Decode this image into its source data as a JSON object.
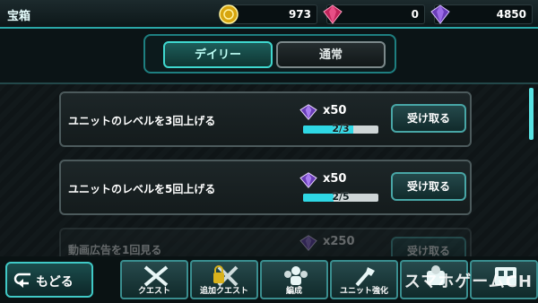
{
  "header": {
    "title": "宝箱",
    "currencies": [
      {
        "name": "gold-coin",
        "value": "973",
        "color": "#f0c419"
      },
      {
        "name": "red-gem",
        "value": "0",
        "color": "#d0336a"
      },
      {
        "name": "purple-gem",
        "value": "4850",
        "color": "#8a5bd6"
      }
    ]
  },
  "tabs": [
    {
      "label": "デイリー",
      "active": true
    },
    {
      "label": "通常",
      "active": false
    }
  ],
  "missions": [
    {
      "text": "ユニットのレベルを3回上げる",
      "reward": "x50",
      "progress": "2/3",
      "progress_ratio": 0.667,
      "button": "受け取る"
    },
    {
      "text": "ユニットのレベルを5回上げる",
      "reward": "x50",
      "progress": "2/5",
      "progress_ratio": 0.4,
      "button": "受け取る"
    },
    {
      "text": "動画広告を1回見る",
      "reward": "x250",
      "progress": "",
      "progress_ratio": 0,
      "button": "受け取る"
    }
  ],
  "bottom_nav": {
    "back_label": "もどる",
    "items": [
      {
        "label": "クエスト",
        "icon": "quest-icon"
      },
      {
        "label": "追加クエスト",
        "icon": "extra-quest-icon"
      },
      {
        "label": "編成",
        "icon": "formation-icon"
      },
      {
        "label": "ユニット強化",
        "icon": "unit-upgrade-icon"
      },
      {
        "label": "",
        "icon": "unit-icon"
      },
      {
        "label": "",
        "icon": "shop-icon"
      }
    ]
  },
  "watermark": "スマホゲームCH"
}
